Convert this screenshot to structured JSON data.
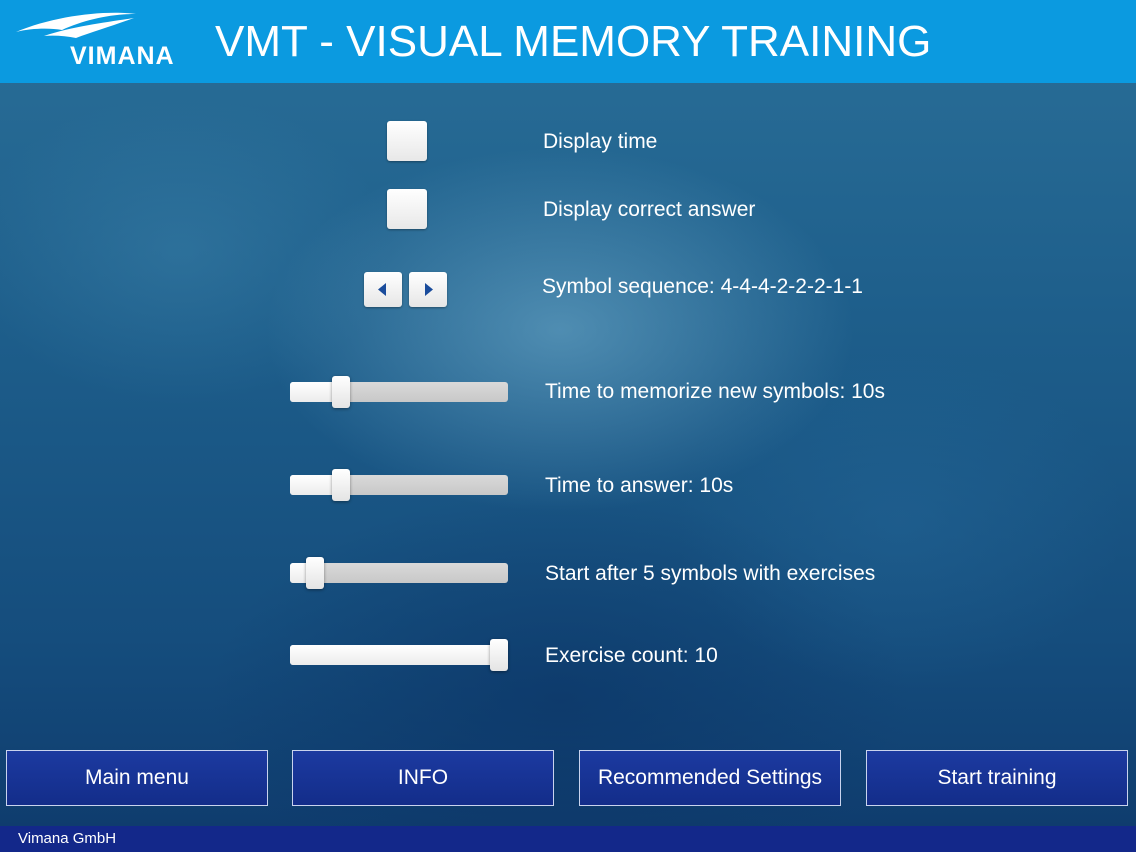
{
  "header": {
    "logo_text": "VIMANA",
    "title": "VMT - VISUAL MEMORY TRAINING"
  },
  "options": {
    "display_time": {
      "label": "Display time",
      "checked": false
    },
    "display_correct_answer": {
      "label": "Display correct answer",
      "checked": false
    },
    "symbol_sequence": {
      "label": "Symbol sequence: 4-4-4-2-2-2-1-1"
    }
  },
  "sliders": [
    {
      "label": "Time to memorize new symbols: 10s",
      "fraction": 0.21
    },
    {
      "label": "Time to answer: 10s",
      "fraction": 0.21
    },
    {
      "label": "Start after 5 symbols with exercises",
      "fraction": 0.08
    },
    {
      "label": "Exercise count: 10",
      "fraction": 1.0
    }
  ],
  "buttons": {
    "main_menu": "Main menu",
    "info": "INFO",
    "recommended_settings": "Recommended Settings",
    "start_training": "Start training"
  },
  "footer": {
    "company": "Vimana GmbH"
  },
  "colors": {
    "header": "#0b9ae0",
    "button": "#132d8a",
    "footer": "#13288a"
  }
}
